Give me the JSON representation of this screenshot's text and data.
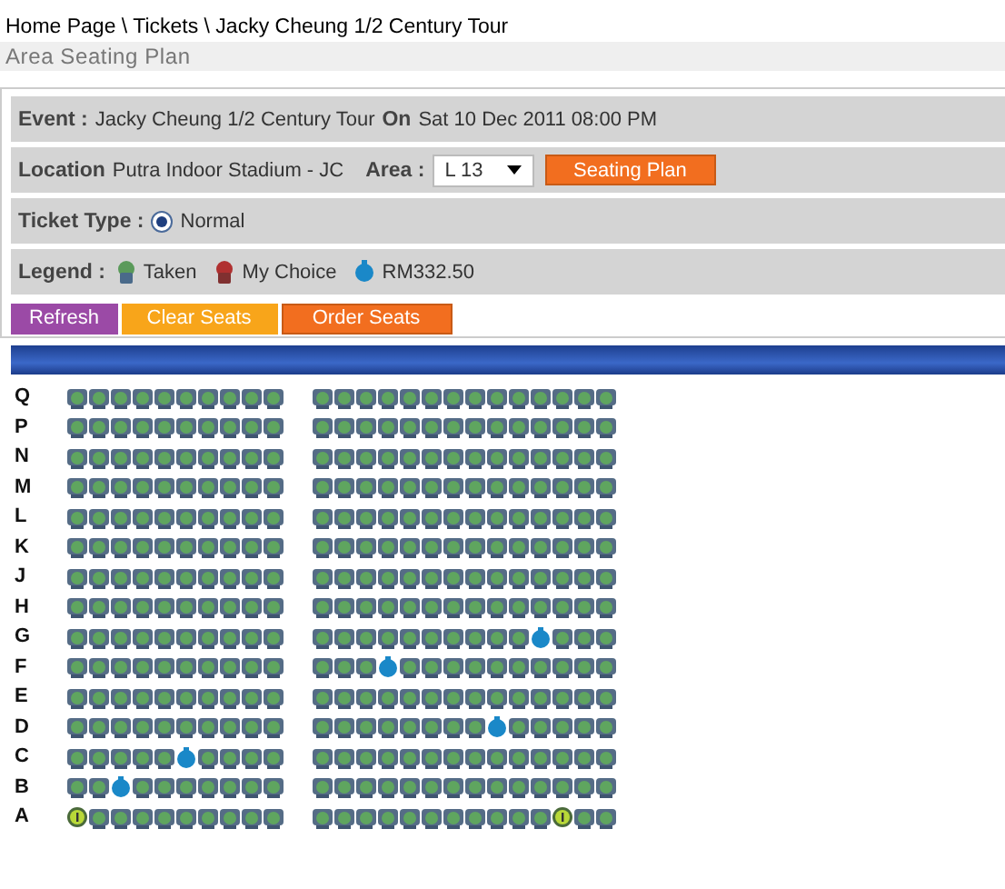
{
  "breadcrumb": "Home Page \\ Tickets \\ Jacky Cheung 1/2 Century Tour",
  "section_title": "Area Seating Plan",
  "event": {
    "label": "Event :",
    "name": "Jacky Cheung 1/2 Century Tour",
    "on_label": "On",
    "date": "Sat 10 Dec 2011 08:00 PM"
  },
  "location": {
    "label": "Location",
    "value": "Putra Indoor Stadium - JC",
    "area_label": "Area :",
    "area_value": "L 13",
    "button": "Seating Plan"
  },
  "ticket_type": {
    "label": "Ticket Type :",
    "options": [
      {
        "label": "Normal",
        "selected": true
      }
    ]
  },
  "legend": {
    "label": "Legend :",
    "items": [
      {
        "kind": "taken",
        "label": "Taken"
      },
      {
        "kind": "mine",
        "label": "My Choice"
      },
      {
        "kind": "available",
        "label": "RM332.50"
      }
    ]
  },
  "buttons": [
    {
      "kind": "refresh",
      "label": "Refresh"
    },
    {
      "kind": "clear",
      "label": "Clear Seats"
    },
    {
      "kind": "order",
      "label": "Order Seats"
    }
  ],
  "rows": [
    {
      "label": "Q",
      "left": [
        {
          "kind": "taken"
        },
        {
          "kind": "taken"
        },
        {
          "kind": "taken"
        },
        {
          "kind": "taken"
        },
        {
          "kind": "taken"
        },
        {
          "kind": "taken"
        },
        {
          "kind": "taken"
        },
        {
          "kind": "taken"
        },
        {
          "kind": "taken"
        },
        {
          "kind": "taken"
        }
      ],
      "right": [
        {
          "kind": "taken"
        },
        {
          "kind": "taken"
        },
        {
          "kind": "taken"
        },
        {
          "kind": "taken"
        },
        {
          "kind": "taken"
        },
        {
          "kind": "taken"
        },
        {
          "kind": "taken"
        },
        {
          "kind": "taken"
        },
        {
          "kind": "taken"
        },
        {
          "kind": "taken"
        },
        {
          "kind": "taken"
        },
        {
          "kind": "taken"
        },
        {
          "kind": "taken"
        },
        {
          "kind": "taken"
        }
      ]
    },
    {
      "label": "P",
      "left": [
        {
          "kind": "taken"
        },
        {
          "kind": "taken"
        },
        {
          "kind": "taken"
        },
        {
          "kind": "taken"
        },
        {
          "kind": "taken"
        },
        {
          "kind": "taken"
        },
        {
          "kind": "taken"
        },
        {
          "kind": "taken"
        },
        {
          "kind": "taken"
        },
        {
          "kind": "taken"
        }
      ],
      "right": [
        {
          "kind": "taken"
        },
        {
          "kind": "taken"
        },
        {
          "kind": "taken"
        },
        {
          "kind": "taken"
        },
        {
          "kind": "taken"
        },
        {
          "kind": "taken"
        },
        {
          "kind": "taken"
        },
        {
          "kind": "taken"
        },
        {
          "kind": "taken"
        },
        {
          "kind": "taken"
        },
        {
          "kind": "taken"
        },
        {
          "kind": "taken"
        },
        {
          "kind": "taken"
        },
        {
          "kind": "taken"
        }
      ]
    },
    {
      "label": "N",
      "left": [
        {
          "kind": "taken"
        },
        {
          "kind": "taken"
        },
        {
          "kind": "taken"
        },
        {
          "kind": "taken"
        },
        {
          "kind": "taken"
        },
        {
          "kind": "taken"
        },
        {
          "kind": "taken"
        },
        {
          "kind": "taken"
        },
        {
          "kind": "taken"
        },
        {
          "kind": "taken"
        }
      ],
      "right": [
        {
          "kind": "taken"
        },
        {
          "kind": "taken"
        },
        {
          "kind": "taken"
        },
        {
          "kind": "taken"
        },
        {
          "kind": "taken"
        },
        {
          "kind": "taken"
        },
        {
          "kind": "taken"
        },
        {
          "kind": "taken"
        },
        {
          "kind": "taken"
        },
        {
          "kind": "taken"
        },
        {
          "kind": "taken"
        },
        {
          "kind": "taken"
        },
        {
          "kind": "taken"
        },
        {
          "kind": "taken"
        }
      ]
    },
    {
      "label": "M",
      "left": [
        {
          "kind": "taken"
        },
        {
          "kind": "taken"
        },
        {
          "kind": "taken"
        },
        {
          "kind": "taken"
        },
        {
          "kind": "taken"
        },
        {
          "kind": "taken"
        },
        {
          "kind": "taken"
        },
        {
          "kind": "taken"
        },
        {
          "kind": "taken"
        },
        {
          "kind": "taken"
        }
      ],
      "right": [
        {
          "kind": "taken"
        },
        {
          "kind": "taken"
        },
        {
          "kind": "taken"
        },
        {
          "kind": "taken"
        },
        {
          "kind": "taken"
        },
        {
          "kind": "taken"
        },
        {
          "kind": "taken"
        },
        {
          "kind": "taken"
        },
        {
          "kind": "taken"
        },
        {
          "kind": "taken"
        },
        {
          "kind": "taken"
        },
        {
          "kind": "taken"
        },
        {
          "kind": "taken"
        },
        {
          "kind": "taken"
        }
      ]
    },
    {
      "label": "L",
      "left": [
        {
          "kind": "taken"
        },
        {
          "kind": "taken"
        },
        {
          "kind": "taken"
        },
        {
          "kind": "taken"
        },
        {
          "kind": "taken"
        },
        {
          "kind": "taken"
        },
        {
          "kind": "taken"
        },
        {
          "kind": "taken"
        },
        {
          "kind": "taken"
        },
        {
          "kind": "taken"
        }
      ],
      "right": [
        {
          "kind": "taken"
        },
        {
          "kind": "taken"
        },
        {
          "kind": "taken"
        },
        {
          "kind": "taken"
        },
        {
          "kind": "taken"
        },
        {
          "kind": "taken"
        },
        {
          "kind": "taken"
        },
        {
          "kind": "taken"
        },
        {
          "kind": "taken"
        },
        {
          "kind": "taken"
        },
        {
          "kind": "taken"
        },
        {
          "kind": "taken"
        },
        {
          "kind": "taken"
        },
        {
          "kind": "taken"
        }
      ]
    },
    {
      "label": "K",
      "left": [
        {
          "kind": "taken"
        },
        {
          "kind": "taken"
        },
        {
          "kind": "taken"
        },
        {
          "kind": "taken"
        },
        {
          "kind": "taken"
        },
        {
          "kind": "taken"
        },
        {
          "kind": "taken"
        },
        {
          "kind": "taken"
        },
        {
          "kind": "taken"
        },
        {
          "kind": "taken"
        }
      ],
      "right": [
        {
          "kind": "taken"
        },
        {
          "kind": "taken"
        },
        {
          "kind": "taken"
        },
        {
          "kind": "taken"
        },
        {
          "kind": "taken"
        },
        {
          "kind": "taken"
        },
        {
          "kind": "taken"
        },
        {
          "kind": "taken"
        },
        {
          "kind": "taken"
        },
        {
          "kind": "taken"
        },
        {
          "kind": "taken"
        },
        {
          "kind": "taken"
        },
        {
          "kind": "taken"
        },
        {
          "kind": "taken"
        }
      ]
    },
    {
      "label": "J",
      "left": [
        {
          "kind": "taken"
        },
        {
          "kind": "taken"
        },
        {
          "kind": "taken"
        },
        {
          "kind": "taken"
        },
        {
          "kind": "taken"
        },
        {
          "kind": "taken"
        },
        {
          "kind": "taken"
        },
        {
          "kind": "taken"
        },
        {
          "kind": "taken"
        },
        {
          "kind": "taken"
        }
      ],
      "right": [
        {
          "kind": "taken"
        },
        {
          "kind": "taken"
        },
        {
          "kind": "taken"
        },
        {
          "kind": "taken"
        },
        {
          "kind": "taken"
        },
        {
          "kind": "taken"
        },
        {
          "kind": "taken"
        },
        {
          "kind": "taken"
        },
        {
          "kind": "taken"
        },
        {
          "kind": "taken"
        },
        {
          "kind": "taken"
        },
        {
          "kind": "taken"
        },
        {
          "kind": "taken"
        },
        {
          "kind": "taken"
        }
      ]
    },
    {
      "label": "H",
      "left": [
        {
          "kind": "taken"
        },
        {
          "kind": "taken"
        },
        {
          "kind": "taken"
        },
        {
          "kind": "taken"
        },
        {
          "kind": "taken"
        },
        {
          "kind": "taken"
        },
        {
          "kind": "taken"
        },
        {
          "kind": "taken"
        },
        {
          "kind": "taken"
        },
        {
          "kind": "taken"
        }
      ],
      "right": [
        {
          "kind": "taken"
        },
        {
          "kind": "taken"
        },
        {
          "kind": "taken"
        },
        {
          "kind": "taken"
        },
        {
          "kind": "taken"
        },
        {
          "kind": "taken"
        },
        {
          "kind": "taken"
        },
        {
          "kind": "taken"
        },
        {
          "kind": "taken"
        },
        {
          "kind": "taken"
        },
        {
          "kind": "taken"
        },
        {
          "kind": "taken"
        },
        {
          "kind": "taken"
        },
        {
          "kind": "taken"
        }
      ]
    },
    {
      "label": "G",
      "left": [
        {
          "kind": "taken"
        },
        {
          "kind": "taken"
        },
        {
          "kind": "taken"
        },
        {
          "kind": "taken"
        },
        {
          "kind": "taken"
        },
        {
          "kind": "taken"
        },
        {
          "kind": "taken"
        },
        {
          "kind": "taken"
        },
        {
          "kind": "taken"
        },
        {
          "kind": "taken"
        }
      ],
      "right": [
        {
          "kind": "taken"
        },
        {
          "kind": "taken"
        },
        {
          "kind": "taken"
        },
        {
          "kind": "taken"
        },
        {
          "kind": "taken"
        },
        {
          "kind": "taken"
        },
        {
          "kind": "taken"
        },
        {
          "kind": "taken"
        },
        {
          "kind": "taken"
        },
        {
          "kind": "taken"
        },
        {
          "kind": "available"
        },
        {
          "kind": "taken"
        },
        {
          "kind": "taken"
        },
        {
          "kind": "taken"
        }
      ]
    },
    {
      "label": "F",
      "left": [
        {
          "kind": "taken"
        },
        {
          "kind": "taken"
        },
        {
          "kind": "taken"
        },
        {
          "kind": "taken"
        },
        {
          "kind": "taken"
        },
        {
          "kind": "taken"
        },
        {
          "kind": "taken"
        },
        {
          "kind": "taken"
        },
        {
          "kind": "taken"
        },
        {
          "kind": "taken"
        }
      ],
      "right": [
        {
          "kind": "taken"
        },
        {
          "kind": "taken"
        },
        {
          "kind": "taken"
        },
        {
          "kind": "available"
        },
        {
          "kind": "taken"
        },
        {
          "kind": "taken"
        },
        {
          "kind": "taken"
        },
        {
          "kind": "taken"
        },
        {
          "kind": "taken"
        },
        {
          "kind": "taken"
        },
        {
          "kind": "taken"
        },
        {
          "kind": "taken"
        },
        {
          "kind": "taken"
        },
        {
          "kind": "taken"
        }
      ]
    },
    {
      "label": "E",
      "left": [
        {
          "kind": "taken"
        },
        {
          "kind": "taken"
        },
        {
          "kind": "taken"
        },
        {
          "kind": "taken"
        },
        {
          "kind": "taken"
        },
        {
          "kind": "taken"
        },
        {
          "kind": "taken"
        },
        {
          "kind": "taken"
        },
        {
          "kind": "taken"
        },
        {
          "kind": "taken"
        }
      ],
      "right": [
        {
          "kind": "taken"
        },
        {
          "kind": "taken"
        },
        {
          "kind": "taken"
        },
        {
          "kind": "taken"
        },
        {
          "kind": "taken"
        },
        {
          "kind": "taken"
        },
        {
          "kind": "taken"
        },
        {
          "kind": "taken"
        },
        {
          "kind": "taken"
        },
        {
          "kind": "taken"
        },
        {
          "kind": "taken"
        },
        {
          "kind": "taken"
        },
        {
          "kind": "taken"
        },
        {
          "kind": "taken"
        }
      ]
    },
    {
      "label": "D",
      "left": [
        {
          "kind": "taken"
        },
        {
          "kind": "taken"
        },
        {
          "kind": "taken"
        },
        {
          "kind": "taken"
        },
        {
          "kind": "taken"
        },
        {
          "kind": "taken"
        },
        {
          "kind": "taken"
        },
        {
          "kind": "taken"
        },
        {
          "kind": "taken"
        },
        {
          "kind": "taken"
        }
      ],
      "right": [
        {
          "kind": "taken"
        },
        {
          "kind": "taken"
        },
        {
          "kind": "taken"
        },
        {
          "kind": "taken"
        },
        {
          "kind": "taken"
        },
        {
          "kind": "taken"
        },
        {
          "kind": "taken"
        },
        {
          "kind": "taken"
        },
        {
          "kind": "available"
        },
        {
          "kind": "taken"
        },
        {
          "kind": "taken"
        },
        {
          "kind": "taken"
        },
        {
          "kind": "taken"
        },
        {
          "kind": "taken"
        }
      ]
    },
    {
      "label": "C",
      "left": [
        {
          "kind": "taken"
        },
        {
          "kind": "taken"
        },
        {
          "kind": "taken"
        },
        {
          "kind": "taken"
        },
        {
          "kind": "taken"
        },
        {
          "kind": "available"
        },
        {
          "kind": "taken"
        },
        {
          "kind": "taken"
        },
        {
          "kind": "taken"
        },
        {
          "kind": "taken"
        }
      ],
      "right": [
        {
          "kind": "taken"
        },
        {
          "kind": "taken"
        },
        {
          "kind": "taken"
        },
        {
          "kind": "taken"
        },
        {
          "kind": "taken"
        },
        {
          "kind": "taken"
        },
        {
          "kind": "taken"
        },
        {
          "kind": "taken"
        },
        {
          "kind": "taken"
        },
        {
          "kind": "taken"
        },
        {
          "kind": "taken"
        },
        {
          "kind": "taken"
        },
        {
          "kind": "taken"
        },
        {
          "kind": "taken"
        }
      ]
    },
    {
      "label": "B",
      "left": [
        {
          "kind": "taken"
        },
        {
          "kind": "taken"
        },
        {
          "kind": "available"
        },
        {
          "kind": "taken"
        },
        {
          "kind": "taken"
        },
        {
          "kind": "taken"
        },
        {
          "kind": "taken"
        },
        {
          "kind": "taken"
        },
        {
          "kind": "taken"
        },
        {
          "kind": "taken"
        }
      ],
      "right": [
        {
          "kind": "taken"
        },
        {
          "kind": "taken"
        },
        {
          "kind": "taken"
        },
        {
          "kind": "taken"
        },
        {
          "kind": "taken"
        },
        {
          "kind": "taken"
        },
        {
          "kind": "taken"
        },
        {
          "kind": "taken"
        },
        {
          "kind": "taken"
        },
        {
          "kind": "taken"
        },
        {
          "kind": "taken"
        },
        {
          "kind": "taken"
        },
        {
          "kind": "taken"
        },
        {
          "kind": "taken"
        }
      ]
    },
    {
      "label": "A",
      "left": [
        {
          "kind": "special"
        },
        {
          "kind": "taken"
        },
        {
          "kind": "taken"
        },
        {
          "kind": "taken"
        },
        {
          "kind": "taken"
        },
        {
          "kind": "taken"
        },
        {
          "kind": "taken"
        },
        {
          "kind": "taken"
        },
        {
          "kind": "taken"
        },
        {
          "kind": "taken"
        }
      ],
      "right": [
        {
          "kind": "taken"
        },
        {
          "kind": "taken"
        },
        {
          "kind": "taken"
        },
        {
          "kind": "taken"
        },
        {
          "kind": "taken"
        },
        {
          "kind": "taken"
        },
        {
          "kind": "taken"
        },
        {
          "kind": "taken"
        },
        {
          "kind": "taken"
        },
        {
          "kind": "taken"
        },
        {
          "kind": "taken"
        },
        {
          "kind": "special"
        },
        {
          "kind": "taken"
        },
        {
          "kind": "taken"
        }
      ]
    }
  ]
}
